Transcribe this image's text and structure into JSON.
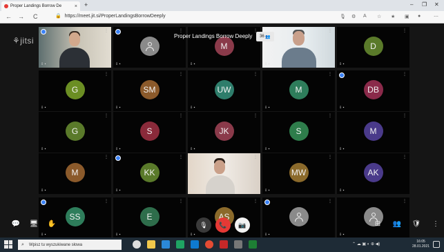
{
  "browser": {
    "tab_title": "Proper Landings Borrow De",
    "tab_close": "×",
    "new_tab": "+",
    "url": "https://meet.jit.si/ProperLandingsBorrowDeeply",
    "win_min": "–",
    "win_max": "❐",
    "win_close": "✕",
    "back": "←",
    "forward": "→",
    "reload": "C"
  },
  "meeting": {
    "logo": "jitsi",
    "title": "Proper Landings Borrow Deeply",
    "participant_count": "36"
  },
  "tiles": [
    {
      "type": "video",
      "variant": "v1",
      "badge": true
    },
    {
      "type": "avatar",
      "initials": "",
      "color": "#8a8a8a",
      "badge": true
    },
    {
      "type": "avatar",
      "initials": "M",
      "color": "#8a3a4a",
      "badge": false
    },
    {
      "type": "video",
      "variant": "v2",
      "badge": false
    },
    {
      "type": "avatar",
      "initials": "D",
      "color": "#5a7a2a",
      "badge": false
    },
    {
      "type": "avatar",
      "initials": "G",
      "color": "#6b8e23",
      "badge": false
    },
    {
      "type": "avatar",
      "initials": "SM",
      "color": "#8b5a2b",
      "badge": false
    },
    {
      "type": "avatar",
      "initials": "UW",
      "color": "#2e7d6b",
      "badge": false
    },
    {
      "type": "avatar",
      "initials": "M",
      "color": "#2e7d5b",
      "badge": false
    },
    {
      "type": "avatar",
      "initials": "DB",
      "color": "#8a2a4a",
      "badge": true
    },
    {
      "type": "avatar",
      "initials": "G",
      "color": "#5a7a2a",
      "badge": false
    },
    {
      "type": "avatar",
      "initials": "S",
      "color": "#8a2a3a",
      "badge": false
    },
    {
      "type": "avatar",
      "initials": "JK",
      "color": "#8a3a4a",
      "badge": false
    },
    {
      "type": "avatar",
      "initials": "S",
      "color": "#2e7d4b",
      "badge": false
    },
    {
      "type": "avatar",
      "initials": "M",
      "color": "#4a3a8a",
      "badge": false
    },
    {
      "type": "avatar",
      "initials": "M",
      "color": "#8b5a2b",
      "badge": false
    },
    {
      "type": "avatar",
      "initials": "KK",
      "color": "#5a7a2a",
      "badge": true
    },
    {
      "type": "video",
      "variant": "v3",
      "badge": false
    },
    {
      "type": "avatar",
      "initials": "MW",
      "color": "#8b6a2b",
      "badge": false
    },
    {
      "type": "avatar",
      "initials": "AK",
      "color": "#4a3a8a",
      "badge": false
    },
    {
      "type": "avatar",
      "initials": "SS",
      "color": "#2e7d5b",
      "badge": true
    },
    {
      "type": "avatar",
      "initials": "E",
      "color": "#2e6d4b",
      "badge": false
    },
    {
      "type": "avatar",
      "initials": "AS",
      "color": "#8b6a2b",
      "badge": false
    },
    {
      "type": "avatar",
      "initials": "",
      "color": "#8a8a8a",
      "badge": true
    },
    {
      "type": "avatar",
      "initials": "",
      "color": "#8a8a8a",
      "badge": false
    }
  ],
  "toolbar": {
    "chat_icon": "💬",
    "screen_icon": "🖥",
    "hand_icon": "✋",
    "mic_icon": "🎙",
    "hangup_icon": "📞",
    "camera_icon": "📷",
    "tile_icon": "⊞",
    "invite_icon": "👥",
    "security_icon": "🛡",
    "more_icon": "⋮"
  },
  "taskbar": {
    "search_placeholder": "Wpisz tu wyszukiwane słowa",
    "time": "16:05",
    "date": "28.01.2021"
  }
}
